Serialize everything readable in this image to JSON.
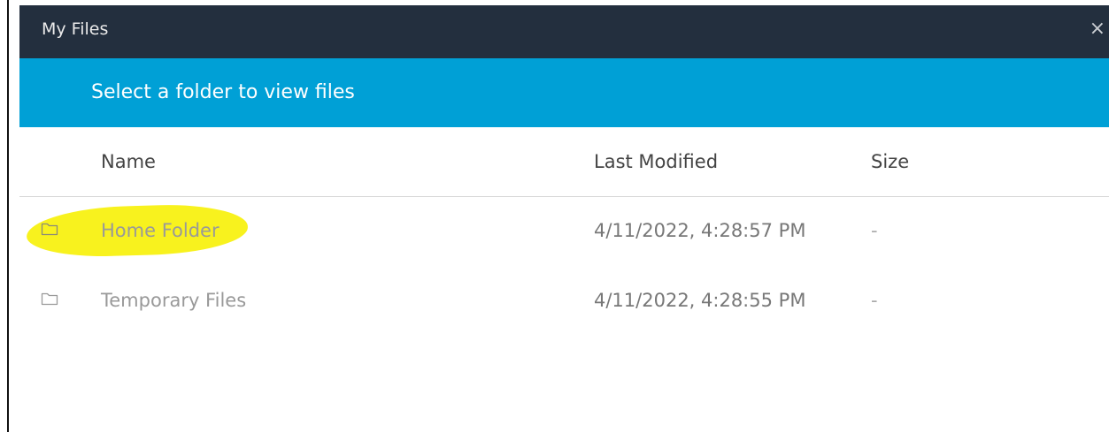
{
  "dialog": {
    "title": "My Files",
    "close_symbol": "×"
  },
  "banner": {
    "text": "Select a folder to view files"
  },
  "table": {
    "columns": {
      "name": "Name",
      "last_modified": "Last Modified",
      "size": "Size"
    },
    "rows": [
      {
        "icon": "folder-icon",
        "name": "Home Folder",
        "last_modified": "4/11/2022, 4:28:57 PM",
        "size": "-",
        "highlighted": true,
        "highlight_color": "#f8f21e"
      },
      {
        "icon": "folder-icon",
        "name": "Temporary Files",
        "last_modified": "4/11/2022, 4:28:55 PM",
        "size": "-",
        "highlighted": false
      }
    ]
  },
  "colors": {
    "title_bar": "#232f3e",
    "banner": "#00a0d6"
  }
}
